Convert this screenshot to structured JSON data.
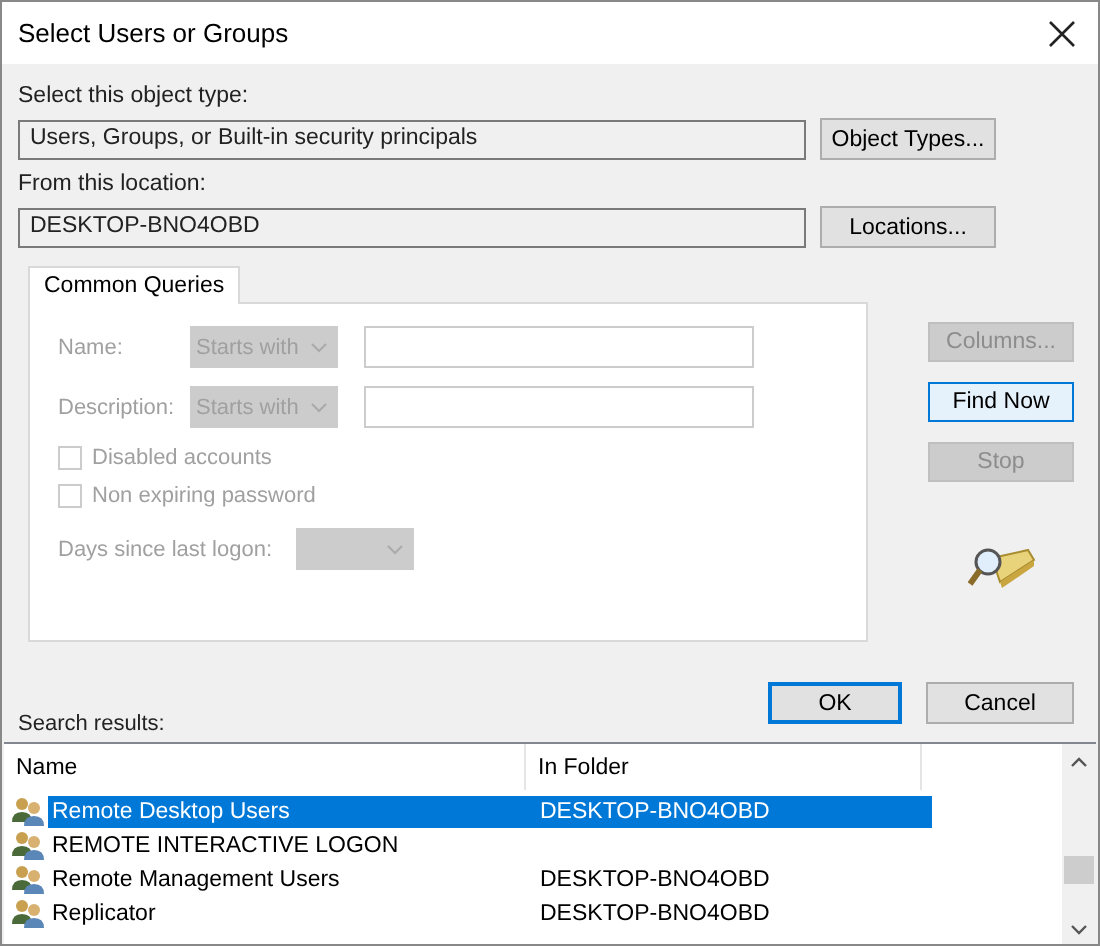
{
  "window": {
    "title": "Select Users or Groups"
  },
  "object_type": {
    "label": "Select this object type:",
    "value": "Users, Groups, or Built-in security principals",
    "button": "Object Types..."
  },
  "location": {
    "label": "From this location:",
    "value": "DESKTOP-BNO4OBD",
    "button": "Locations..."
  },
  "tabs": [
    {
      "label": "Common Queries",
      "selected": true
    }
  ],
  "query": {
    "disabled": true,
    "fields": [
      {
        "label": "Name:",
        "mode": "Starts with"
      },
      {
        "label": "Description:",
        "mode": "Starts with"
      }
    ],
    "checkboxes": [
      {
        "label": "Disabled accounts",
        "checked": false
      },
      {
        "label": "Non expiring password",
        "checked": false
      }
    ],
    "days": {
      "label": "Days since last logon:"
    }
  },
  "side_buttons": [
    {
      "label": "Columns...",
      "disabled": true,
      "focused": false
    },
    {
      "label": "Find Now",
      "disabled": false,
      "focused": true
    },
    {
      "label": "Stop",
      "disabled": true,
      "focused": false
    }
  ],
  "buttons": [
    {
      "label": "OK",
      "default": true
    },
    {
      "label": "Cancel",
      "default": false
    }
  ],
  "results": {
    "label": "Search results:",
    "columns": [
      "Name",
      "In Folder"
    ],
    "rows": [
      {
        "name": "Remote Desktop Users",
        "in_folder": "DESKTOP-BNO4OBD",
        "selected": true
      },
      {
        "name": "REMOTE INTERACTIVE LOGON",
        "selected": false
      },
      {
        "name": "Remote Management Users",
        "in_folder": "DESKTOP-BNO4OBD",
        "selected": false
      },
      {
        "name": "Replicator",
        "in_folder": "DESKTOP-BNO4OBD",
        "selected": false
      }
    ]
  }
}
